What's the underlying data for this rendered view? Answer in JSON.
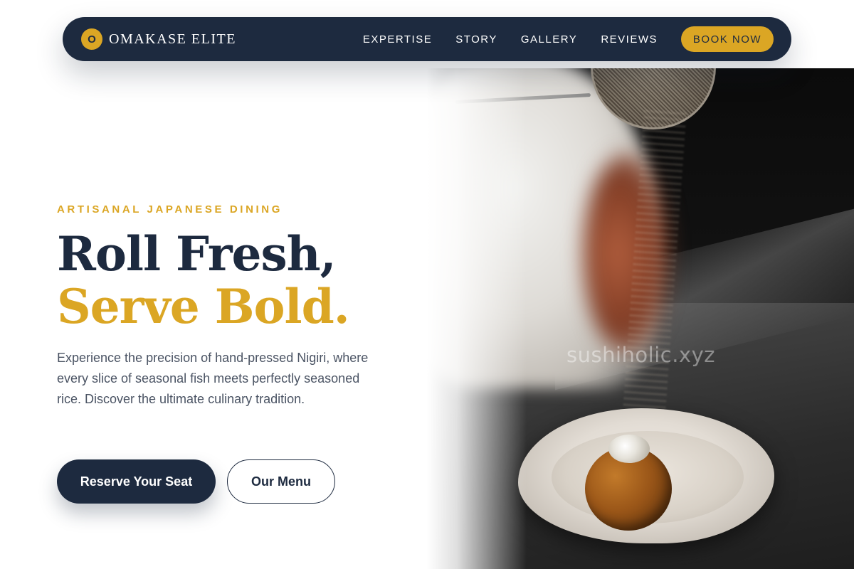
{
  "brand": {
    "badge_letter": "O",
    "name": "OMAKASE ELITE"
  },
  "nav": {
    "links": [
      "EXPERTISE",
      "STORY",
      "GALLERY",
      "REVIEWS"
    ],
    "cta_label": "BOOK NOW"
  },
  "hero": {
    "eyebrow": "ARTISANAL JAPANESE DINING",
    "headline_line1": "Roll Fresh,",
    "headline_line2": "Serve Bold.",
    "description": "Experience the precision of hand-pressed Nigiri, where every slice of seasonal fish meets perfectly seasoned rice. Discover the ultimate culinary tradition.",
    "primary_cta": "Reserve Your Seat",
    "secondary_cta": "Our Menu",
    "image_subject": "sushi-ball-in-ceramic-shell-dish",
    "watermark": "sushiholic.xyz"
  },
  "colors": {
    "navy": "#1d2a3f",
    "gold": "#dba624",
    "body_text": "#4a5363",
    "background": "#ffffff"
  }
}
